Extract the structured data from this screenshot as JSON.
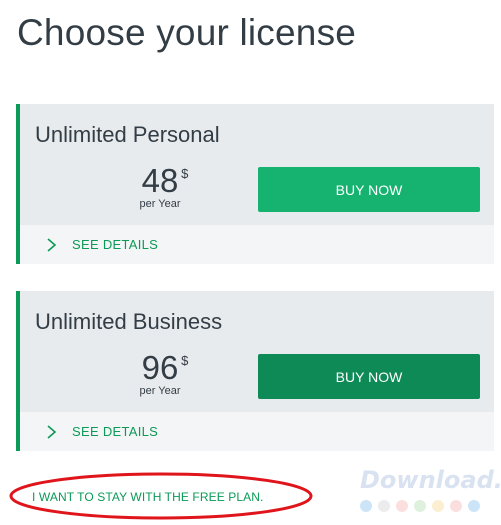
{
  "page": {
    "title": "Choose your license"
  },
  "plans": [
    {
      "name": "Unlimited Personal",
      "price": "48",
      "currency": "$",
      "period": "per Year",
      "buy_label": "BUY NOW",
      "details_label": "SEE DETAILS",
      "button_color": "#15b36f"
    },
    {
      "name": "Unlimited Business",
      "price": "96",
      "currency": "$",
      "period": "per Year",
      "buy_label": "BUY NOW",
      "details_label": "SEE DETAILS",
      "button_color": "#0e8a56"
    }
  ],
  "free_plan": {
    "label": "I WANT TO STAY WITH THE FREE PLAN."
  },
  "watermark": {
    "text": "Download.com.vn",
    "dot_colors": [
      "#6cb2e8",
      "#c9c9c9",
      "#f4a3a3",
      "#9fd89f",
      "#f6d27a",
      "#f4a3a3",
      "#6cb2e8"
    ]
  },
  "colors": {
    "accent": "#0b9a57",
    "annotation": "#e0141b",
    "card_bg": "#e8ebee"
  },
  "icons": {
    "details": "chevron-right-icon"
  }
}
